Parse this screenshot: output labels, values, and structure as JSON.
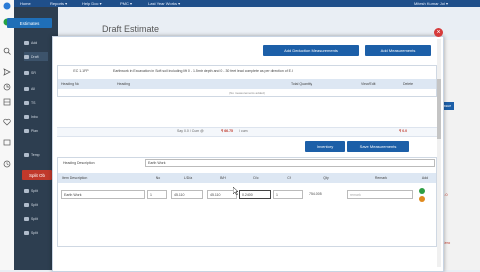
{
  "nav": {
    "items": [
      "Home",
      "Reports ▾",
      "Help Doc ▾",
      "PMC ▾",
      "Last Year Works ▾"
    ],
    "user": "Mitesh Kumar Joi ▾"
  },
  "sidebar": {
    "section1": "Estimates",
    "items1": [
      "Add",
      "Draft",
      "SR",
      "All",
      "TS",
      "Inbo",
      "Plan",
      "Temp"
    ],
    "section2": "Split Ob",
    "items2": [
      "Split",
      "Split",
      "Split",
      "Split"
    ]
  },
  "page": {
    "title": "Draft Estimate"
  },
  "modal": {
    "add_deduction_label": "Add Deduction Measurements",
    "add_measurements_label": "Add Measurements",
    "item_no": "EC 1.1FP",
    "item_text": "Earthwork in Excavation in Soft soil including lift 0 - 1.5mtr depth and 0 - 30 feet lead complete as per direction of E.I",
    "heading_col": "Heading No",
    "heading_label": "Heading",
    "total_qty_label": "Total Quantity",
    "view_edit_label": "View/Edit",
    "delete_label": "Delete",
    "empty_text": "(No measurements added)",
    "say_text": "Say 0.0 / Cum @",
    "rate_text": "₹ 66.75",
    "rate_unit": "/ cum",
    "total_text": "₹ 0.0",
    "inventory_label": "Inventory",
    "save_label": "Save Measurements",
    "heading_desc_label": "Heading Description",
    "heading_desc_value": "Earth Work",
    "columns": [
      "Item Description",
      "No",
      "L/D/a",
      "B/H",
      "D/c",
      "Cf",
      "Qty",
      "Remark",
      "Add"
    ],
    "row": {
      "item": "Earth Work",
      "no": "1",
      "l": "45.110",
      "b": "45.110",
      "d": "0.2400",
      "cf": "1",
      "qty": "754.005",
      "remark": "remark"
    }
  },
  "right_strip": {
    "badge1": "Issue",
    "amount1": "0.0",
    "amount2": "Zero"
  },
  "colors": {
    "nav": "#1f4f8a",
    "sidebar": "#2d3e50",
    "button": "#1c5fa8",
    "accent_red": "#c0392b",
    "add_green": "#2e9e44",
    "remove_orange": "#e08a1e"
  }
}
